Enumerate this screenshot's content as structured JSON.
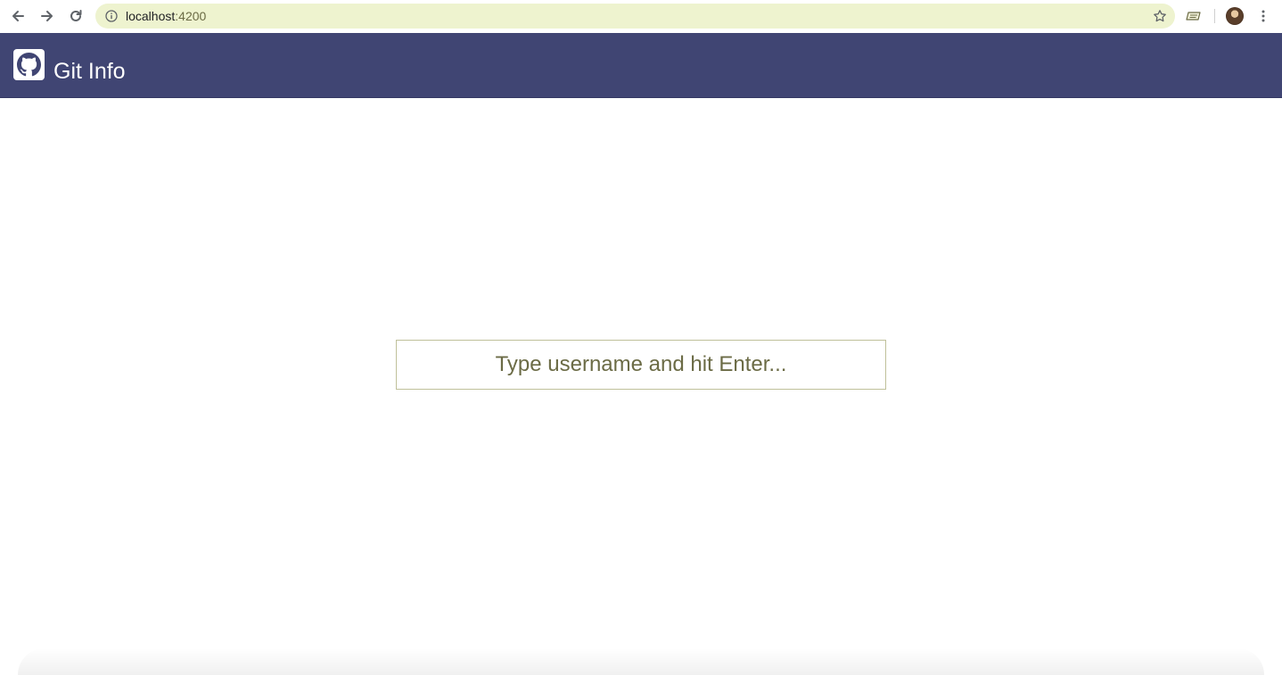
{
  "browser": {
    "url_host": "localhost",
    "url_port": ":4200",
    "icons": {
      "back": "arrow-left-icon",
      "forward": "arrow-right-icon",
      "reload": "reload-icon",
      "site_info": "info-icon",
      "bookmark": "star-icon",
      "extension": "extension-icon",
      "profile": "avatar",
      "menu": "kebab-menu-icon"
    },
    "omnibox_color": "#eef3cf"
  },
  "header": {
    "title": "Git Info",
    "logo_icon": "github-icon",
    "background": "#404573"
  },
  "search": {
    "placeholder": "Type username and hit Enter...",
    "value": ""
  }
}
